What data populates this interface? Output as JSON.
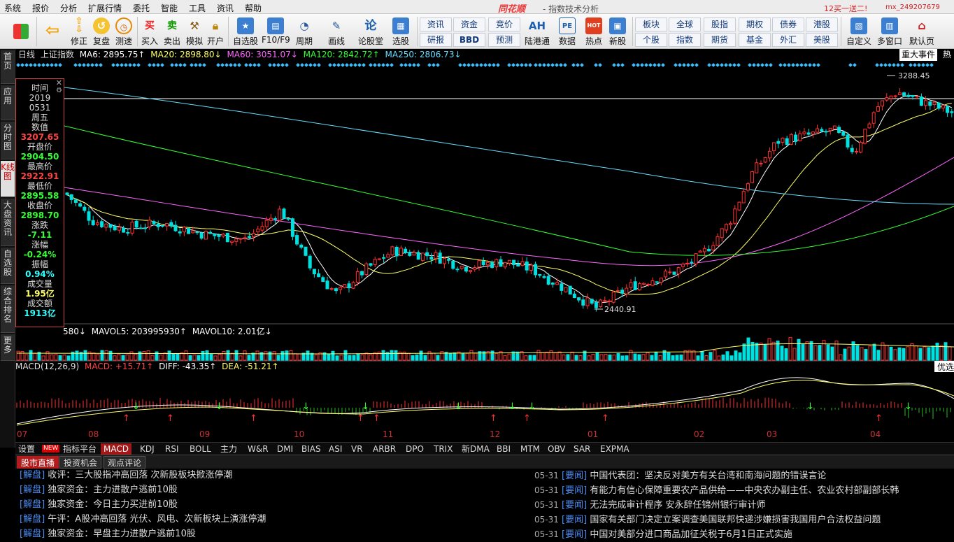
{
  "menu": {
    "items": [
      "系统",
      "报价",
      "分析",
      "扩展行情",
      "委托",
      "智能",
      "工具",
      "资讯",
      "帮助"
    ],
    "brand": "同花顺",
    "subtitle": "- 指数技术分析",
    "promo": "12买一送二!",
    "user": "mx_249207679"
  },
  "toolbar": {
    "buttons": [
      {
        "label": "",
        "icon": "grid-icon"
      },
      {
        "label": "",
        "icon": "back-arrow-icon"
      },
      {
        "label": "修正",
        "icon": "up-arrow-icon"
      },
      {
        "label": "复盘",
        "icon": "replay-icon"
      },
      {
        "label": "测速",
        "icon": "clock-icon"
      },
      {
        "label": "买入",
        "icon": "buy-icon",
        "glyph": "买"
      },
      {
        "label": "卖出",
        "icon": "sell-icon",
        "glyph": "卖"
      },
      {
        "label": "模拟",
        "icon": "hammer-icon"
      },
      {
        "label": "开户",
        "icon": "lock-icon"
      },
      {
        "label": "自选股",
        "icon": "star-icon"
      },
      {
        "label": "F10/F9",
        "icon": "doc-icon"
      },
      {
        "label": "周期",
        "icon": "clock-period-icon"
      },
      {
        "label": "画线",
        "icon": "pen-icon"
      },
      {
        "label": "论股堂",
        "icon": "discuss-icon",
        "glyph": "论"
      },
      {
        "label": "选股",
        "icon": "select-icon"
      },
      {
        "label": "陆港通",
        "icon": "ah-icon",
        "glyph": "AH"
      },
      {
        "label": "数据",
        "icon": "pe-icon",
        "glyph": "PE"
      },
      {
        "label": "热点",
        "icon": "hot-icon",
        "glyph": "HOT"
      },
      {
        "label": "新股",
        "icon": "newstock-icon"
      },
      {
        "label": "自定义",
        "icon": "custom-icon"
      },
      {
        "label": "多窗口",
        "icon": "multiwin-icon"
      },
      {
        "label": "默认页",
        "icon": "home-icon"
      }
    ],
    "small_buttons": [
      "资讯",
      "研报",
      "资金",
      "BBD",
      "竞价",
      "预测",
      "板块",
      "个股",
      "全球",
      "指数",
      "股指",
      "期货",
      "期权",
      "基金",
      "债券",
      "外汇",
      "港股",
      "美股"
    ]
  },
  "left_tabs": [
    "首页",
    "应用",
    "分时图",
    "K线图",
    "大盘资讯",
    "自选股",
    "综合排名",
    "更多"
  ],
  "header": {
    "period": "日线",
    "index": "上证指数",
    "ma6": "MA6: 2895.75↑",
    "ma20": "MA20: 2898.80↓",
    "ma60": "MA60: 3051.07↓",
    "ma120": "MA120: 2842.72↑",
    "ma250": "MA250: 2806.73↓",
    "events": "重大事件",
    "hot": "热"
  },
  "info": {
    "time_label": "时间",
    "year": "2019",
    "date": "0531",
    "weekday": "周五",
    "value_label": "数值",
    "value": "3207.65",
    "open_label": "开盘价",
    "open": "2904.50",
    "high_label": "最高价",
    "high": "2922.91",
    "low_label": "最低价",
    "low": "2895.58",
    "close_label": "收盘价",
    "close": "2898.70",
    "chg_label": "涨跌",
    "chg": "-7.11",
    "pct_label": "涨幅",
    "pct": "-0.24%",
    "amp_label": "振幅",
    "amp": "0.94%",
    "vol_label": "成交量",
    "vol": "1.95亿",
    "amt_label": "成交额",
    "amt": "1913亿"
  },
  "volume_header": {
    "vol": "580↓",
    "mavol5": "MAVOL5: 203995930↑",
    "mavol10": "MAVOL10: 2.01亿↓"
  },
  "macd_header": {
    "name": "MACD(12,26,9)",
    "macd": "MACD: +15.71↑",
    "diff": "DIFF: -43.35↑",
    "dea": "DEA: -51.21↑"
  },
  "right_labels": {
    "optimize": "优选"
  },
  "chart_data": {
    "type": "candlestick",
    "title": "上证指数",
    "period": "日线",
    "x_labels": [
      "07",
      "08",
      "09",
      "10",
      "11",
      "12",
      "01",
      "02",
      "03",
      "04"
    ],
    "annotations": [
      {
        "label": "3288.45"
      },
      {
        "label": "2440.91"
      }
    ],
    "colors": {
      "up": "#ff3030",
      "down": "#00e0e0",
      "ma6": "#ffffff",
      "ma20": "#ffff66",
      "ma60": "#ff66ff",
      "ma120": "#33ff33",
      "ma250": "#66ddff"
    },
    "note": "daily K-line Jul 2018 – May 2019 with volume and MACD panels; approximate path low 2440.91, high 3288.45"
  },
  "indicator_tabs": [
    "设置",
    "NEW",
    "指标平台",
    "MACD",
    "KDJ",
    "RSI",
    "BOLL",
    "主力",
    "W&R",
    "DMI",
    "BIAS",
    "ASI",
    "VR",
    "ARBR",
    "DPO",
    "TRIX",
    "新DMA",
    "BBI",
    "MTM",
    "OBV",
    "SAR",
    "EXPMA"
  ],
  "news_tabs": [
    "股市直播",
    "投资机会",
    "观点评论"
  ],
  "news_left": [
    {
      "tag": "[解盘]",
      "text": "收评：三大股指冲高回落 次新股板块掀涨停潮"
    },
    {
      "tag": "[解盘]",
      "text": "独家资金：主力进散户逃前10股"
    },
    {
      "tag": "[解盘]",
      "text": "独家资金：今日主力买进前10股"
    },
    {
      "tag": "[解盘]",
      "text": "午评：A股冲高回落 光伏、风电、次新板块上演涨停潮"
    },
    {
      "tag": "[解盘]",
      "text": "独家资金：早盘主力进散户逃前10股"
    }
  ],
  "news_right": [
    {
      "date": "05-31",
      "tag": "[要闻]",
      "text": "中国代表团：坚决反对美方有关台湾和南海问题的错误言论"
    },
    {
      "date": "05-31",
      "tag": "[要闻]",
      "text": "有能力有信心保障重要农产品供给——中央农办副主任、农业农村部副部长韩"
    },
    {
      "date": "05-31",
      "tag": "[要闻]",
      "text": "无法完成审计程序 安永辞任锦州银行审计师"
    },
    {
      "date": "05-31",
      "tag": "[要闻]",
      "text": "国家有关部门决定立案调查美国联邦快递涉嫌损害我国用户合法权益问题"
    },
    {
      "date": "05-31",
      "tag": "[要闻]",
      "text": "中国对美部分进口商品加征关税于6月1日正式实施"
    }
  ]
}
